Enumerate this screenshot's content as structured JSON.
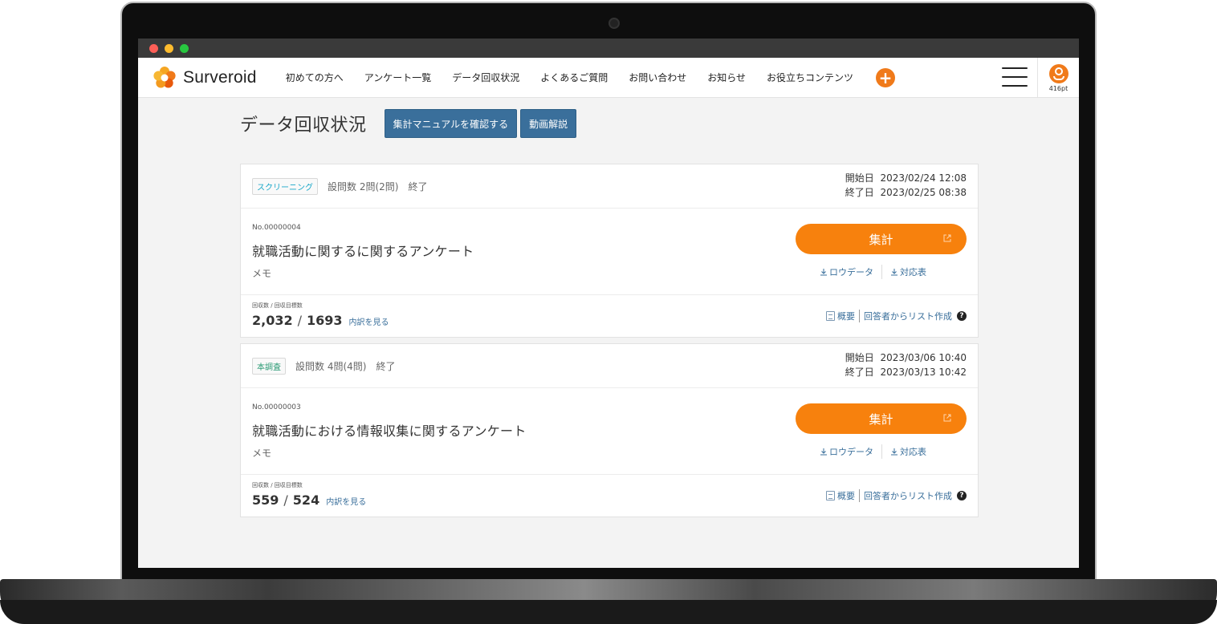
{
  "app": {
    "name": "Surveroid"
  },
  "nav": {
    "items": [
      {
        "label": "初めての方へ"
      },
      {
        "label": "アンケート一覧"
      },
      {
        "label": "データ回収状況"
      },
      {
        "label": "よくあるご質問"
      },
      {
        "label": "お問い合わせ"
      },
      {
        "label": "お知らせ"
      },
      {
        "label": "お役立ちコンテンツ"
      }
    ],
    "plus_label": "+"
  },
  "user": {
    "points": "416pt"
  },
  "page": {
    "title": "データ回収状況",
    "manual_button": "集計マニュアルを確認する",
    "video_button": "動画解説"
  },
  "surveys": [
    {
      "tag": "スクリーニング",
      "questions": "設問数  2問(2問)",
      "status": "終了",
      "start_label": "開始日",
      "start": "2023/02/24 12:08",
      "end_label": "終了日",
      "end": "2023/02/25 08:38",
      "number": "No.00000004",
      "title": "就職活動に関するに関するアンケート",
      "memo": "メモ",
      "aggregate_button": "集計",
      "raw_data": "ロウデータ",
      "mapping": "対応表",
      "count_label": "回収数 / 回収目標数",
      "collected": "2,032",
      "slash": "/",
      "target": "1693",
      "breakdown": "内訳を見る",
      "summary": "概要",
      "list_create": "回答者からリスト作成",
      "help": "?"
    },
    {
      "tag": "本調査",
      "questions": "設問数  4問(4問)",
      "status": "終了",
      "start_label": "開始日",
      "start": "2023/03/06 10:40",
      "end_label": "終了日",
      "end": "2023/03/13 10:42",
      "number": "No.00000003",
      "title": "就職活動における情報収集に関するアンケート",
      "memo": "メモ",
      "aggregate_button": "集計",
      "raw_data": "ロウデータ",
      "mapping": "対応表",
      "count_label": "回収数 / 回収目標数",
      "collected": "559",
      "slash": "/",
      "target": "524",
      "breakdown": "内訳を見る",
      "summary": "概要",
      "list_create": "回答者からリスト作成",
      "help": "?"
    }
  ],
  "colors": {
    "accent_orange": "#f7810d",
    "button_blue": "#3a6f9b",
    "tag_screening": "#1ba8c9",
    "tag_main": "#2a9a74"
  },
  "icons": {
    "logo": "surveroid-logo-icon",
    "plus": "plus-icon",
    "menu": "hamburger-menu-icon",
    "user": "user-avatar-icon",
    "external": "external-link-icon",
    "download": "download-icon",
    "document": "document-icon",
    "help": "help-icon"
  }
}
